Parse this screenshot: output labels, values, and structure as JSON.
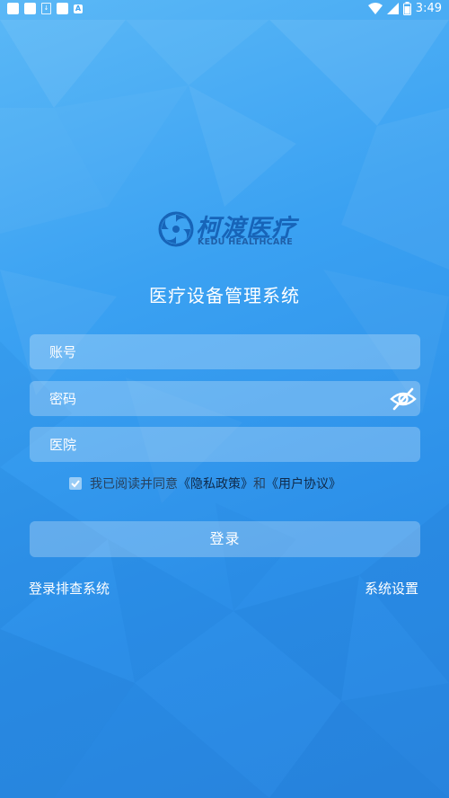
{
  "status_bar": {
    "time": "3:49",
    "notification_icons": [
      "square-icon",
      "square-icon",
      "download-icon",
      "square-icon",
      "a-icon"
    ],
    "a_label": "A",
    "system_icons": [
      "wifi-icon",
      "signal-icon",
      "battery-icon"
    ]
  },
  "brand": {
    "name_cn": "柯渡医疗",
    "name_en": "KEDU HEALTHCARE"
  },
  "app_title": "医疗设备管理系统",
  "form": {
    "account_placeholder": "账号",
    "password_placeholder": "密码",
    "hospital_placeholder": "医院",
    "agree_text": "我已阅读并同意",
    "privacy_link": "《隐私政策》",
    "and_text": "和",
    "user_agreement_link": "《用户协议》",
    "agree_checked": true
  },
  "actions": {
    "login_label": "登录",
    "troubleshoot_label": "登录排查系统",
    "settings_label": "系统设置"
  },
  "colors": {
    "background_top": "#5bb8f6",
    "background_bottom": "#2a86e0",
    "brand_blue": "#1764b8",
    "field_fill": "rgba(255,255,255,0.26)"
  }
}
